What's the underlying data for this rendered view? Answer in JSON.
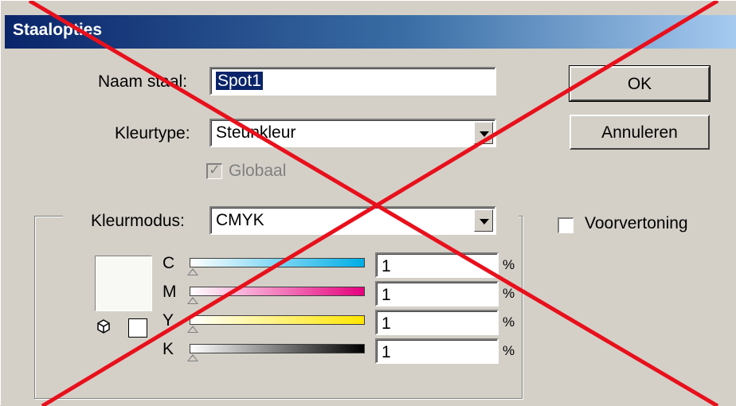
{
  "dialog": {
    "title": "Staalopties"
  },
  "fields": {
    "naam_label": "Naam staal:",
    "naam_value": "Spot1",
    "kleurtype_label": "Kleurtype:",
    "kleurtype_value": "Steunkleur",
    "globaal_label": "Globaal",
    "kleurmodus_label": "Kleurmodus:",
    "kleurmodus_value": "CMYK"
  },
  "buttons": {
    "ok": "OK",
    "cancel": "Annuleren"
  },
  "preview": {
    "label": "Voorvertoning",
    "checked": false
  },
  "channels": [
    {
      "name": "C",
      "value": "1",
      "unit": "%",
      "gradient": [
        "#ffffff",
        "#00aee6"
      ]
    },
    {
      "name": "M",
      "value": "1",
      "unit": "%",
      "gradient": [
        "#ffffff",
        "#e6007e"
      ]
    },
    {
      "name": "Y",
      "value": "1",
      "unit": "%",
      "gradient": [
        "#ffffff",
        "#ffe600"
      ]
    },
    {
      "name": "K",
      "value": "1",
      "unit": "%",
      "gradient": [
        "#ffffff",
        "#000000"
      ]
    }
  ],
  "overlay": {
    "color": "#e8101c"
  }
}
